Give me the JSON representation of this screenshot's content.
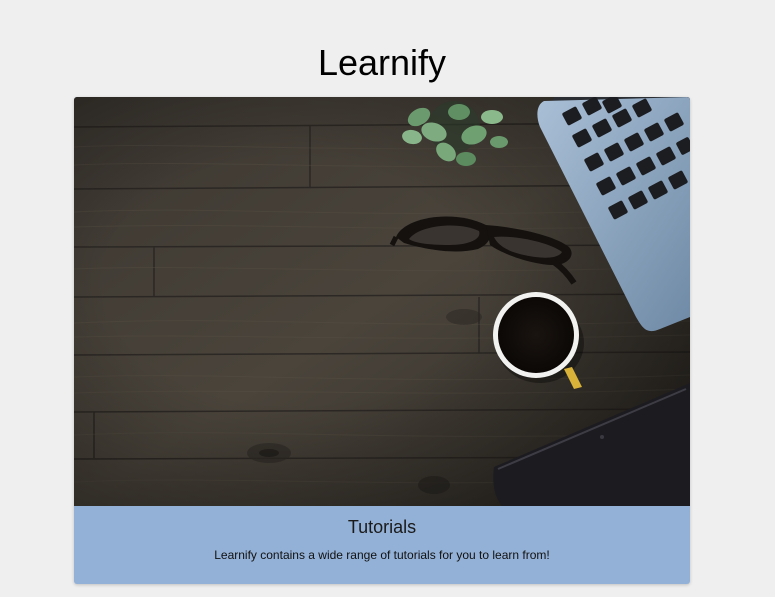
{
  "header": {
    "title": "Learnify"
  },
  "card": {
    "image_alt": "Wooden desk with laptop, glasses, coffee cup, plant and tablet",
    "title": "Tutorials",
    "description": "Learnify contains a wide range of tutorials for you to learn from!"
  },
  "colors": {
    "page_background": "#efefef",
    "card_footer": "#93b1d6"
  }
}
